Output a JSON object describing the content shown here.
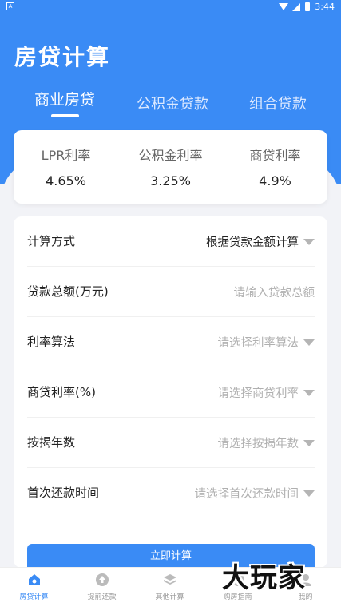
{
  "status_bar": {
    "left_badge": "A",
    "time": "3:44"
  },
  "header": {
    "title": "房贷计算"
  },
  "tabs": [
    {
      "label": "商业房贷",
      "active": true
    },
    {
      "label": "公积金贷款",
      "active": false
    },
    {
      "label": "组合贷款",
      "active": false
    }
  ],
  "rates": [
    {
      "label": "LPR利率",
      "value": "4.65%"
    },
    {
      "label": "公积金利率",
      "value": "3.25%"
    },
    {
      "label": "商贷利率",
      "value": "4.9%"
    }
  ],
  "form": {
    "rows": [
      {
        "label": "计算方式",
        "value": "根据贷款金额计算",
        "is_placeholder": false,
        "dropdown": true
      },
      {
        "label": "贷款总额(万元)",
        "value": "请输入贷款总额",
        "is_placeholder": true,
        "dropdown": false
      },
      {
        "label": "利率算法",
        "value": "请选择利率算法",
        "is_placeholder": true,
        "dropdown": true
      },
      {
        "label": "商贷利率(%)",
        "value": "请选择商贷利率",
        "is_placeholder": true,
        "dropdown": true
      },
      {
        "label": "按揭年数",
        "value": "请选择按揭年数",
        "is_placeholder": true,
        "dropdown": true
      },
      {
        "label": "首次还款时间",
        "value": "请选择首次还款时间",
        "is_placeholder": true,
        "dropdown": true
      }
    ],
    "submit_label": "立即计算"
  },
  "bottom_nav": [
    {
      "label": "房贷计算",
      "icon": "home-icon",
      "active": true
    },
    {
      "label": "提前还款",
      "icon": "upload-circle-icon",
      "active": false
    },
    {
      "label": "其他计算",
      "icon": "layers-icon",
      "active": false
    },
    {
      "label": "购房指南",
      "icon": "guide-icon",
      "active": false
    },
    {
      "label": "我的",
      "icon": "user-icon",
      "active": false
    }
  ],
  "watermark": "大玩家",
  "colors": {
    "primary": "#3a8bf5",
    "background": "#f2f3f7",
    "placeholder": "#b0b0b0"
  }
}
